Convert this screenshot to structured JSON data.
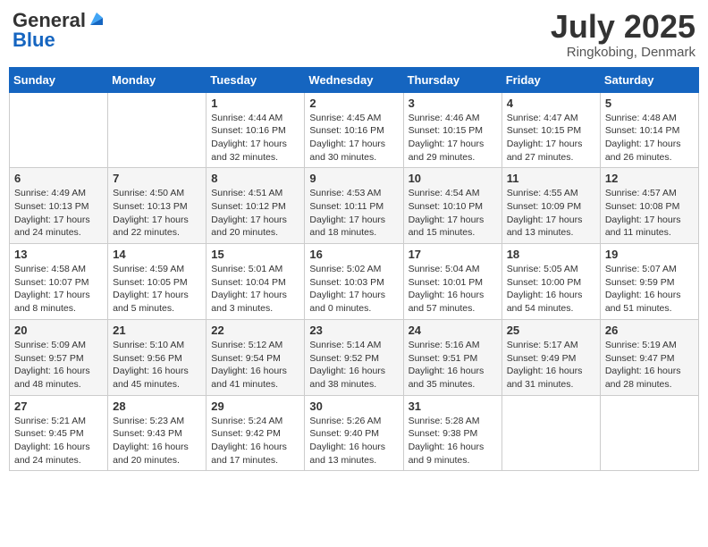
{
  "header": {
    "logo_general": "General",
    "logo_blue": "Blue",
    "month_title": "July 2025",
    "location": "Ringkobing, Denmark"
  },
  "weekdays": [
    "Sunday",
    "Monday",
    "Tuesday",
    "Wednesday",
    "Thursday",
    "Friday",
    "Saturday"
  ],
  "weeks": [
    [
      {
        "day": "",
        "info": ""
      },
      {
        "day": "",
        "info": ""
      },
      {
        "day": "1",
        "info": "Sunrise: 4:44 AM\nSunset: 10:16 PM\nDaylight: 17 hours and 32 minutes."
      },
      {
        "day": "2",
        "info": "Sunrise: 4:45 AM\nSunset: 10:16 PM\nDaylight: 17 hours and 30 minutes."
      },
      {
        "day": "3",
        "info": "Sunrise: 4:46 AM\nSunset: 10:15 PM\nDaylight: 17 hours and 29 minutes."
      },
      {
        "day": "4",
        "info": "Sunrise: 4:47 AM\nSunset: 10:15 PM\nDaylight: 17 hours and 27 minutes."
      },
      {
        "day": "5",
        "info": "Sunrise: 4:48 AM\nSunset: 10:14 PM\nDaylight: 17 hours and 26 minutes."
      }
    ],
    [
      {
        "day": "6",
        "info": "Sunrise: 4:49 AM\nSunset: 10:13 PM\nDaylight: 17 hours and 24 minutes."
      },
      {
        "day": "7",
        "info": "Sunrise: 4:50 AM\nSunset: 10:13 PM\nDaylight: 17 hours and 22 minutes."
      },
      {
        "day": "8",
        "info": "Sunrise: 4:51 AM\nSunset: 10:12 PM\nDaylight: 17 hours and 20 minutes."
      },
      {
        "day": "9",
        "info": "Sunrise: 4:53 AM\nSunset: 10:11 PM\nDaylight: 17 hours and 18 minutes."
      },
      {
        "day": "10",
        "info": "Sunrise: 4:54 AM\nSunset: 10:10 PM\nDaylight: 17 hours and 15 minutes."
      },
      {
        "day": "11",
        "info": "Sunrise: 4:55 AM\nSunset: 10:09 PM\nDaylight: 17 hours and 13 minutes."
      },
      {
        "day": "12",
        "info": "Sunrise: 4:57 AM\nSunset: 10:08 PM\nDaylight: 17 hours and 11 minutes."
      }
    ],
    [
      {
        "day": "13",
        "info": "Sunrise: 4:58 AM\nSunset: 10:07 PM\nDaylight: 17 hours and 8 minutes."
      },
      {
        "day": "14",
        "info": "Sunrise: 4:59 AM\nSunset: 10:05 PM\nDaylight: 17 hours and 5 minutes."
      },
      {
        "day": "15",
        "info": "Sunrise: 5:01 AM\nSunset: 10:04 PM\nDaylight: 17 hours and 3 minutes."
      },
      {
        "day": "16",
        "info": "Sunrise: 5:02 AM\nSunset: 10:03 PM\nDaylight: 17 hours and 0 minutes."
      },
      {
        "day": "17",
        "info": "Sunrise: 5:04 AM\nSunset: 10:01 PM\nDaylight: 16 hours and 57 minutes."
      },
      {
        "day": "18",
        "info": "Sunrise: 5:05 AM\nSunset: 10:00 PM\nDaylight: 16 hours and 54 minutes."
      },
      {
        "day": "19",
        "info": "Sunrise: 5:07 AM\nSunset: 9:59 PM\nDaylight: 16 hours and 51 minutes."
      }
    ],
    [
      {
        "day": "20",
        "info": "Sunrise: 5:09 AM\nSunset: 9:57 PM\nDaylight: 16 hours and 48 minutes."
      },
      {
        "day": "21",
        "info": "Sunrise: 5:10 AM\nSunset: 9:56 PM\nDaylight: 16 hours and 45 minutes."
      },
      {
        "day": "22",
        "info": "Sunrise: 5:12 AM\nSunset: 9:54 PM\nDaylight: 16 hours and 41 minutes."
      },
      {
        "day": "23",
        "info": "Sunrise: 5:14 AM\nSunset: 9:52 PM\nDaylight: 16 hours and 38 minutes."
      },
      {
        "day": "24",
        "info": "Sunrise: 5:16 AM\nSunset: 9:51 PM\nDaylight: 16 hours and 35 minutes."
      },
      {
        "day": "25",
        "info": "Sunrise: 5:17 AM\nSunset: 9:49 PM\nDaylight: 16 hours and 31 minutes."
      },
      {
        "day": "26",
        "info": "Sunrise: 5:19 AM\nSunset: 9:47 PM\nDaylight: 16 hours and 28 minutes."
      }
    ],
    [
      {
        "day": "27",
        "info": "Sunrise: 5:21 AM\nSunset: 9:45 PM\nDaylight: 16 hours and 24 minutes."
      },
      {
        "day": "28",
        "info": "Sunrise: 5:23 AM\nSunset: 9:43 PM\nDaylight: 16 hours and 20 minutes."
      },
      {
        "day": "29",
        "info": "Sunrise: 5:24 AM\nSunset: 9:42 PM\nDaylight: 16 hours and 17 minutes."
      },
      {
        "day": "30",
        "info": "Sunrise: 5:26 AM\nSunset: 9:40 PM\nDaylight: 16 hours and 13 minutes."
      },
      {
        "day": "31",
        "info": "Sunrise: 5:28 AM\nSunset: 9:38 PM\nDaylight: 16 hours and 9 minutes."
      },
      {
        "day": "",
        "info": ""
      },
      {
        "day": "",
        "info": ""
      }
    ]
  ]
}
